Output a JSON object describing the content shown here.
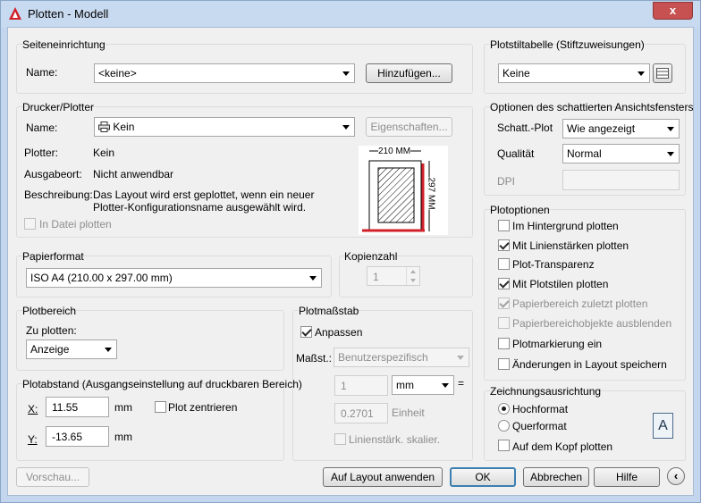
{
  "window": {
    "title": "Plotten - Modell",
    "close": "x"
  },
  "page_setup": {
    "group": "Seiteneinrichtung",
    "name_label": "Name:",
    "name_value": "<keine>",
    "add_button": "Hinzufügen..."
  },
  "printer": {
    "group": "Drucker/Plotter",
    "name_label": "Name:",
    "name_value": "Kein",
    "properties_button": "Eigenschaften...",
    "plotter_label": "Plotter:",
    "plotter_value": "Kein",
    "location_label": "Ausgabeort:",
    "location_value": "Nicht anwendbar",
    "description_label": "Beschreibung:",
    "description_line1": "Das Layout wird erst geplottet, wenn ein neuer",
    "description_line2": "Plotter-Konfigurationsname ausgewählt wird.",
    "plot_to_file": "In Datei plotten",
    "preview_width": "210 MM",
    "preview_height": "297 MM"
  },
  "paper_size": {
    "group": "Papierformat",
    "value": "ISO A4 (210.00 x 297.00 mm)"
  },
  "copies": {
    "group": "Kopienzahl",
    "value": "1"
  },
  "plot_area": {
    "group": "Plotbereich",
    "what_label": "Zu plotten:",
    "what_value": "Anzeige"
  },
  "plot_offset": {
    "group": "Plotabstand (Ausgangseinstellung auf druckbaren Bereich)",
    "x_label": "X:",
    "x_value": "11.55",
    "x_unit": "mm",
    "y_label": "Y:",
    "y_value": "-13.65",
    "y_unit": "mm",
    "center": "Plot zentrieren"
  },
  "plot_scale": {
    "group": "Plotmaßstab",
    "fit": "Anpassen",
    "scale_label": "Maßst.:",
    "scale_value": "Benutzerspezifisch",
    "value1": "1",
    "unit": "mm",
    "equals": "=",
    "value2": "0.2701",
    "unit2": "Einheit",
    "lineweights": "Linienstärk. skalier."
  },
  "plot_style_table": {
    "group": "Plotstiltabelle (Stiftzuweisungen)",
    "value": "Keine"
  },
  "shaded_viewport": {
    "group": "Optionen des schattierten Ansichtsfensters",
    "shade_label": "Schatt.-Plot",
    "shade_value": "Wie angezeigt",
    "quality_label": "Qualität",
    "quality_value": "Normal",
    "dpi_label": "DPI"
  },
  "plot_options": {
    "group": "Plotoptionen",
    "items": [
      {
        "label": "Im Hintergrund plotten",
        "checked": false,
        "disabled": false
      },
      {
        "label": "Mit Linienstärken plotten",
        "checked": true,
        "disabled": false
      },
      {
        "label": "Plot-Transparenz",
        "checked": false,
        "disabled": false
      },
      {
        "label": "Mit Plotstilen plotten",
        "checked": true,
        "disabled": false
      },
      {
        "label": "Papierbereich zuletzt plotten",
        "checked": true,
        "disabled": true
      },
      {
        "label": "Papierbereichobjekte ausblenden",
        "checked": false,
        "disabled": true
      },
      {
        "label": "Plotmarkierung ein",
        "checked": false,
        "disabled": false
      },
      {
        "label": "Änderungen in Layout speichern",
        "checked": false,
        "disabled": false
      }
    ]
  },
  "orientation": {
    "group": "Zeichnungsausrichtung",
    "portrait": "Hochformat",
    "landscape": "Querformat",
    "upside_down": "Auf dem Kopf plotten",
    "icon_letter": "A"
  },
  "footer": {
    "preview": "Vorschau...",
    "apply": "Auf Layout anwenden",
    "ok": "OK",
    "cancel": "Abbrechen",
    "help": "Hilfe"
  },
  "colors": {
    "accent_red": "#d0202a",
    "titlebar": "#c8daf0"
  }
}
